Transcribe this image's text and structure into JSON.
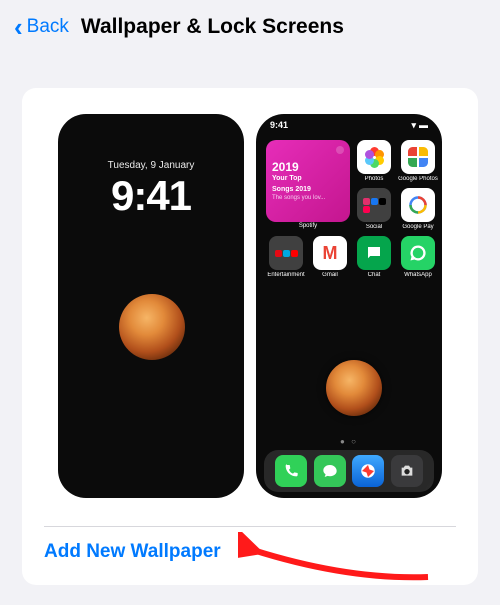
{
  "nav": {
    "back_label": "Back",
    "title": "Wallpaper & Lock Screens"
  },
  "lock_screen": {
    "date": "Tuesday, 9 January",
    "time": "9:41"
  },
  "home_screen": {
    "status_time": "9:41",
    "widget": {
      "year": "2019",
      "line1": "Your Top",
      "line2": "Songs 2019",
      "subtitle": "The songs you lov...",
      "label": "Spotify"
    },
    "apps_row1": [
      {
        "label": "Photos"
      },
      {
        "label": "Google Photos"
      }
    ],
    "apps_row2": [
      {
        "label": "Social"
      },
      {
        "label": "Google Pay"
      }
    ],
    "apps_row3": [
      {
        "label": "Entertainment"
      },
      {
        "label": "Gmail"
      },
      {
        "label": "Chat"
      },
      {
        "label": "WhatsApp"
      }
    ],
    "page_dots": "● ○"
  },
  "action": {
    "add_label": "Add New Wallpaper"
  }
}
